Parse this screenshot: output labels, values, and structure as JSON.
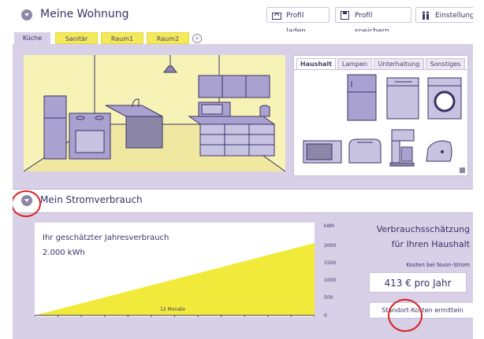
{
  "header": {
    "title": "Meine Wohnung",
    "buttons": {
      "load": "Profil laden",
      "save": "Profil speichern",
      "settings": "Einstellungen"
    }
  },
  "rooms": {
    "tabs": [
      "Küche",
      "Sanitär",
      "Raum1",
      "Raum2"
    ],
    "active": "Küche",
    "add_symbol": "+"
  },
  "appliances": {
    "tabs": [
      "Haushalt",
      "Lampen",
      "Unterhaltung",
      "Sonstiges"
    ],
    "active": "Haushalt",
    "icons": [
      "fridge-icon",
      "dishwasher-icon",
      "washing-machine-icon",
      "microwave-icon",
      "toaster-icon",
      "coffee-maker-icon",
      "iron-icon"
    ]
  },
  "consumption": {
    "section_title": "Mein Stromverbrauch",
    "chart_title": "Ihr geschätzter Jahresverbrauch",
    "chart_value": "2.000 kWh",
    "x_label": "12 Monate",
    "y_unit": "kWh",
    "y_ticks": [
      "2000",
      "1500",
      "1000",
      "500",
      "0"
    ]
  },
  "estimate": {
    "title_line1": "Verbrauchsschätzung",
    "title_line2": "für Ihren Haushalt",
    "cost_label": "Kosten bei Nuon-Strom",
    "cost_value": "413 € pro Jahr",
    "location_button": "Standort-Kosten ermitteln"
  },
  "colors": {
    "background": "#d8d0e6",
    "accent_yellow": "#f2ea5c",
    "text": "#3b3168",
    "highlight_circle": "#d82020"
  },
  "chart_data": {
    "type": "area",
    "title": "Ihr geschätzter Jahresverbrauch",
    "xlabel": "12 Monate",
    "ylabel": "kWh",
    "ylim": [
      0,
      2000
    ],
    "yticks": [
      0,
      500,
      1000,
      1500,
      2000
    ],
    "x": [
      0,
      12
    ],
    "values": [
      0,
      2000
    ]
  }
}
